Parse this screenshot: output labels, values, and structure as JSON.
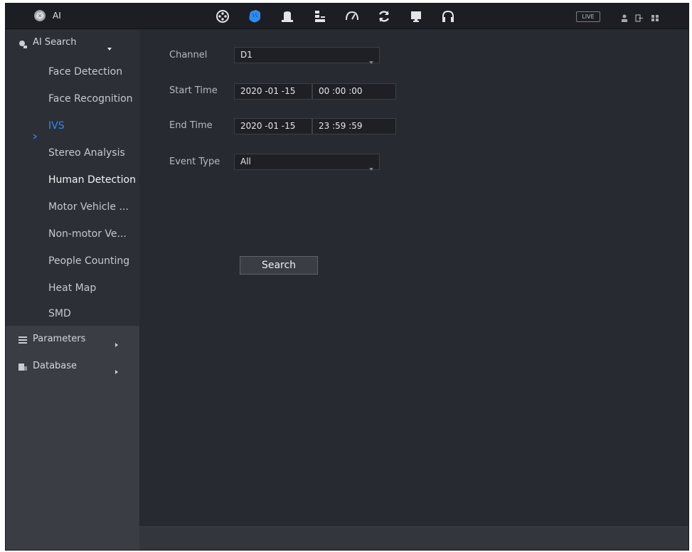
{
  "app": {
    "title": "AI",
    "live_label": "LIVE"
  },
  "topbar": {
    "icons": [
      "film-reel-icon",
      "brain-icon",
      "alarm-icon",
      "storage-icon",
      "gauge-icon",
      "sync-icon",
      "monitor-icon",
      "headset-icon"
    ],
    "active_icon": "brain-icon",
    "right_icons": [
      "user-icon",
      "logout-icon",
      "grid-icon"
    ]
  },
  "sidebar": {
    "ai_search": {
      "label": "AI Search",
      "items": [
        {
          "label": "Face Detection"
        },
        {
          "label": "Face Recognition"
        },
        {
          "label": "IVS"
        },
        {
          "label": "Stereo Analysis"
        },
        {
          "label": "Human Detection"
        },
        {
          "label": "Motor Vehicle ..."
        },
        {
          "label": "Non-motor Ve..."
        },
        {
          "label": "People Counting"
        },
        {
          "label": "Heat Map"
        },
        {
          "label": "SMD"
        }
      ],
      "active_item": "IVS"
    },
    "parameters": {
      "label": "Parameters"
    },
    "database": {
      "label": "Database"
    }
  },
  "form": {
    "channel": {
      "label": "Channel",
      "value": "D1"
    },
    "start_time": {
      "label": "Start Time",
      "date": "2020 -01 -15",
      "time": "00 :00 :00"
    },
    "end_time": {
      "label": "End Time",
      "date": "2020 -01 -15",
      "time": "23 :59 :59"
    },
    "event_type": {
      "label": "Event Type",
      "value": "All"
    },
    "search_label": "Search"
  },
  "colors": {
    "accent": "#2f8cf0",
    "background": "#272a31",
    "sidebar": "#2c2f36"
  }
}
